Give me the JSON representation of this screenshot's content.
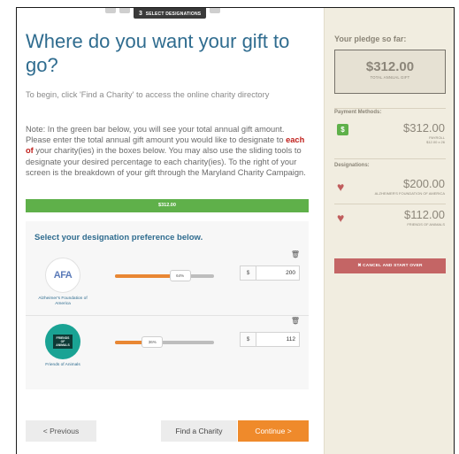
{
  "steps": {
    "active_number": "3",
    "active_label": "SELECT DESIGNATIONS"
  },
  "title": "Where do you want your gift to go?",
  "intro": "To begin, click 'Find a Charity' to access the online charity directory",
  "note": {
    "part1": "Note: In the green bar below, you will see your total annual gift amount. Please enter the total annual gift amount you would like to designate to ",
    "highlight": "each of",
    "part2": " your charity(ies) in the boxes below. You may also use the sliding tools to designate your desired percentage to each charity(ies). To the right of your screen is the breakdown of your gift through the Maryland Charity Campaign."
  },
  "green_bar_total": "$312.00",
  "panel_heading": "Select your designation preference below.",
  "designations": [
    {
      "logo_text": "AFA",
      "name": "Alzheimer's Foundation of America",
      "percent": "64%",
      "percent_value": 64,
      "currency": "$",
      "amount": "200"
    },
    {
      "logo_text": "FRIENDS OF ANIMALS",
      "name": "Friends of Animals",
      "percent": "36%",
      "percent_value": 36,
      "currency": "$",
      "amount": "112"
    }
  ],
  "buttons": {
    "previous": "< Previous",
    "find": "Find a Charity",
    "continue": "Continue >"
  },
  "sidebar": {
    "title": "Your pledge so far:",
    "pledge_amount": "$312.00",
    "pledge_label": "TOTAL ANNUAL GIFT",
    "payment_methods_label": "Payment Methods:",
    "payment_icon": "$",
    "payment_amount": "$312.00",
    "payment_sub1": "PAYROLL",
    "payment_sub2": "$12.00 x 26",
    "designations_label": "Designations:",
    "designations": [
      {
        "amount": "$200.00",
        "name": "ALZHEIMER'S FOUNDATION OF AMERICA"
      },
      {
        "amount": "$112.00",
        "name": "FRIENDS OF ANIMALS"
      }
    ],
    "cancel_button": "CANCEL AND START OVER"
  },
  "colors": {
    "accent_blue": "#2f6c8f",
    "green": "#5fb04a",
    "orange": "#ef8a2b",
    "cancel_red": "#c46565",
    "heart": "#c05d5d"
  }
}
